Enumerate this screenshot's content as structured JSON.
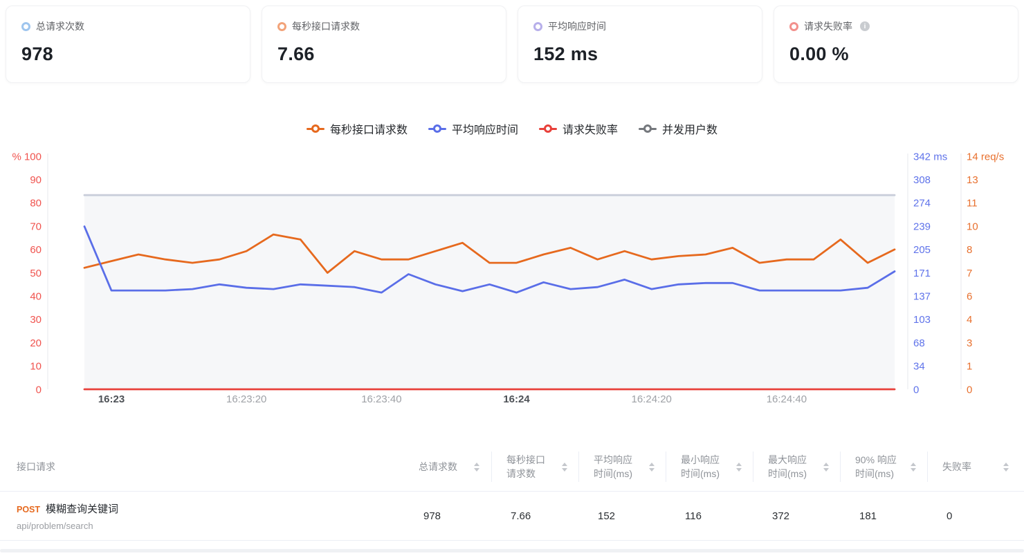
{
  "stats_cards": [
    {
      "label": "总请求次数",
      "value": "978",
      "dot_color": "#9ec5ee",
      "info": false
    },
    {
      "label": "每秒接口请求数",
      "value": "7.66",
      "dot_color": "#f2a379",
      "info": false
    },
    {
      "label": "平均响应时间",
      "value": "152 ms",
      "dot_color": "#b7afea",
      "info": false
    },
    {
      "label": "请求失败率",
      "value": "0.00 %",
      "dot_color": "#f2918d",
      "info": true
    }
  ],
  "chart_data": {
    "type": "line",
    "legend": [
      {
        "label": "每秒接口请求数",
        "color": "#e6691e"
      },
      {
        "label": "平均响应时间",
        "color": "#5a6ee8"
      },
      {
        "label": "请求失败率",
        "color": "#e8403a"
      },
      {
        "label": "并发用户数",
        "color": "#75787d"
      }
    ],
    "x": [
      "16:22:56",
      "16:23:00",
      "16:23:04",
      "16:23:08",
      "16:23:12",
      "16:23:16",
      "16:23:20",
      "16:23:24",
      "16:23:28",
      "16:23:32",
      "16:23:36",
      "16:23:40",
      "16:23:44",
      "16:23:48",
      "16:23:52",
      "16:23:56",
      "16:24:00",
      "16:24:04",
      "16:24:08",
      "16:24:12",
      "16:24:16",
      "16:24:20",
      "16:24:24",
      "16:24:28",
      "16:24:32",
      "16:24:36",
      "16:24:40",
      "16:24:44",
      "16:24:48",
      "16:24:52",
      "16:24:56"
    ],
    "x_tick_labels": [
      {
        "text": "16:23",
        "index": 1,
        "bold": true
      },
      {
        "text": "16:23:20",
        "index": 6,
        "bold": false
      },
      {
        "text": "16:23:40",
        "index": 11,
        "bold": false
      },
      {
        "text": "16:24",
        "index": 16,
        "bold": true
      },
      {
        "text": "16:24:20",
        "index": 21,
        "bold": false
      },
      {
        "text": "16:24:40",
        "index": 26,
        "bold": false
      }
    ],
    "axes": {
      "left_percent": {
        "unit": "%",
        "color": "#f0534e",
        "min": 0,
        "max": 100,
        "ticks": [
          "% 100",
          "90",
          "80",
          "70",
          "60",
          "50",
          "40",
          "30",
          "20",
          "10",
          "0"
        ]
      },
      "right_ms": {
        "unit": "ms",
        "color": "#5f73ea",
        "min": 0,
        "max": 342,
        "ticks": [
          "342 ms",
          "308",
          "274",
          "239",
          "205",
          "171",
          "137",
          "103",
          "68",
          "34",
          "0"
        ]
      },
      "right_rps": {
        "unit": "req/s",
        "color": "#e8702e",
        "min": 0,
        "max": 14,
        "ticks": [
          "14 req/s",
          "13",
          "11",
          "10",
          "8",
          "7",
          "6",
          "4",
          "3",
          "1",
          "0"
        ]
      }
    },
    "series": [
      {
        "id": "rps",
        "name": "每秒接口请求数",
        "color": "#e6691e",
        "axis_max": 14,
        "values": [
          7.3,
          7.7,
          8.1,
          7.8,
          7.6,
          7.8,
          8.3,
          9.3,
          9.0,
          7.0,
          8.3,
          7.8,
          7.8,
          8.3,
          8.8,
          7.6,
          7.6,
          8.1,
          8.5,
          7.8,
          8.3,
          7.8,
          8.0,
          8.1,
          8.5,
          7.6,
          7.8,
          7.8,
          9.0,
          7.6,
          8.4
        ]
      },
      {
        "id": "avg-response",
        "name": "平均响应时间",
        "color": "#5a6ee8",
        "axis_max": 342,
        "values": [
          239,
          145,
          145,
          145,
          147,
          154,
          149,
          147,
          154,
          152,
          150,
          142,
          169,
          154,
          144,
          154,
          142,
          157,
          147,
          150,
          161,
          147,
          154,
          156,
          156,
          145,
          145,
          145,
          145,
          149,
          173
        ]
      },
      {
        "id": "failure-rate",
        "name": "请求失败率",
        "color": "#e8403a",
        "axis_max": 100,
        "values": [
          0,
          0,
          0,
          0,
          0,
          0,
          0,
          0,
          0,
          0,
          0,
          0,
          0,
          0,
          0,
          0,
          0,
          0,
          0,
          0,
          0,
          0,
          0,
          0,
          0,
          0,
          0,
          0,
          0,
          0,
          0
        ]
      },
      {
        "id": "concurrency",
        "name": "并发用户数",
        "color": "#c9ceda",
        "axis_max": 6,
        "area_fill": "#f6f7f9",
        "values": [
          5,
          5,
          5,
          5,
          5,
          5,
          5,
          5,
          5,
          5,
          5,
          5,
          5,
          5,
          5,
          5,
          5,
          5,
          5,
          5,
          5,
          5,
          5,
          5,
          5,
          5,
          5,
          5,
          5,
          5,
          5
        ]
      }
    ]
  },
  "table": {
    "first_column_label": "接口请求",
    "columns": [
      {
        "line1": "总请求数",
        "line2": ""
      },
      {
        "line1": "每秒接口",
        "line2": "请求数"
      },
      {
        "line1": "平均响应",
        "line2": "时间(ms)"
      },
      {
        "line1": "最小响应",
        "line2": "时间(ms)"
      },
      {
        "line1": "最大响应",
        "line2": "时间(ms)"
      },
      {
        "line1": "90% 响应",
        "line2": "时间(ms)"
      },
      {
        "line1": "失败率",
        "line2": ""
      }
    ],
    "rows": [
      {
        "method": "POST",
        "name": "模糊查询关键词",
        "path": "api/problem/search",
        "cells": [
          "978",
          "7.66",
          "152",
          "116",
          "372",
          "181",
          "0"
        ]
      }
    ]
  }
}
